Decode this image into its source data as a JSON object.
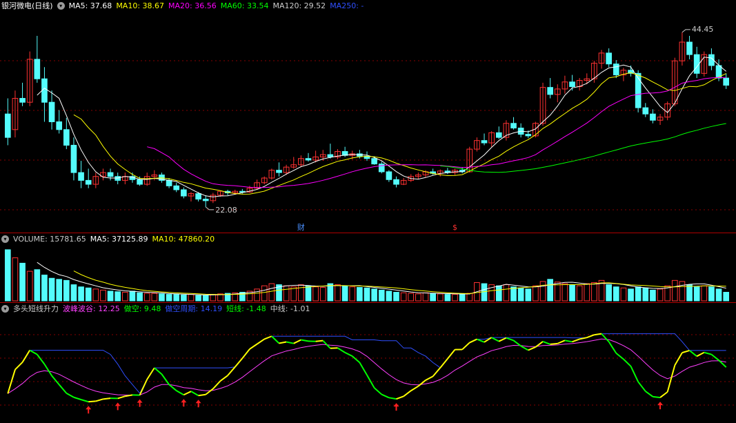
{
  "price_panel": {
    "title": "银河微电(日线)",
    "ma_items": [
      {
        "label": "MA5: 37.68",
        "color": "#ffffff"
      },
      {
        "label": "MA10: 38.67",
        "color": "#ffff00"
      },
      {
        "label": "MA20: 36.56",
        "color": "#ff00ff"
      },
      {
        "label": "MA60: 33.54",
        "color": "#00ff00"
      },
      {
        "label": "MA120: 29.52",
        "color": "#cccccc"
      },
      {
        "label": "MA250: -",
        "color": "#2f4fff"
      }
    ],
    "high_label": "44.45",
    "low_label": "22.08",
    "marker_cai": "财",
    "marker_dollar": "$"
  },
  "volume_panel": {
    "items": [
      {
        "label": "VOLUME: 15781.65",
        "color": "#cccccc"
      },
      {
        "label": "MA5: 37125.89",
        "color": "#ffffff"
      },
      {
        "label": "MA10: 47860.20",
        "color": "#ffff00"
      }
    ]
  },
  "indicator_panel": {
    "items": [
      {
        "label": "多头短线升力",
        "color": "#cccccc"
      },
      {
        "label": "波峰波谷: 12.25",
        "color": "#ff40ff"
      },
      {
        "label": "做空: 9.48",
        "color": "#00ff00"
      },
      {
        "label": "做空周期: 14.19",
        "color": "#2f4fff"
      },
      {
        "label": "短线: -1.48",
        "color": "#00ff00"
      },
      {
        "label": "中线: -1.01",
        "color": "#cccccc"
      }
    ]
  },
  "colors": {
    "up": "#ff3232",
    "down": "#54fcfc",
    "grid": "#8a0000",
    "ma5": "#ffffff",
    "ma10": "#ffff00",
    "ma20": "#ff00ff",
    "ma60": "#00ff00",
    "ma120": "#cccccc",
    "arrow": "#ff2020"
  },
  "chart_data": {
    "type": "candlestick",
    "price_range": [
      20.5,
      47.0
    ],
    "candles": [
      [
        34,
        36,
        30,
        31
      ],
      [
        32,
        37,
        31,
        36
      ],
      [
        36,
        38,
        35,
        35.5
      ],
      [
        35.5,
        42,
        35,
        41
      ],
      [
        41,
        44,
        38,
        38.5
      ],
      [
        38.5,
        40,
        33,
        35.5
      ],
      [
        35.5,
        37,
        32,
        33
      ],
      [
        33,
        34.5,
        31.5,
        32
      ],
      [
        32,
        33.5,
        29.5,
        30
      ],
      [
        30,
        31,
        25.5,
        26.5
      ],
      [
        26.5,
        28,
        24.5,
        25.5
      ],
      [
        25.5,
        27,
        24.5,
        25
      ],
      [
        25,
        26.5,
        24.5,
        26
      ],
      [
        26,
        27,
        25.5,
        26.5
      ],
      [
        26.5,
        27,
        25.5,
        26
      ],
      [
        26,
        26.5,
        25,
        25.5
      ],
      [
        25.5,
        26.5,
        25,
        26
      ],
      [
        26,
        26.5,
        25.2,
        25.6
      ],
      [
        25.6,
        26,
        24.8,
        25
      ],
      [
        25,
        26.5,
        24.8,
        26
      ],
      [
        26,
        26.8,
        25.5,
        26.2
      ],
      [
        26.2,
        26.5,
        25.2,
        25.5
      ],
      [
        25.5,
        25.8,
        24.5,
        24.8
      ],
      [
        24.8,
        25.2,
        24,
        24.3
      ],
      [
        24.3,
        24.6,
        23.2,
        23.5
      ],
      [
        23.5,
        24,
        22.8,
        23.8
      ],
      [
        23.8,
        24,
        22.8,
        23.1
      ],
      [
        23.1,
        23.6,
        22.1,
        22.9
      ],
      [
        22.9,
        23.9,
        22.6,
        23.6
      ],
      [
        23.6,
        24.2,
        23.4,
        24.1
      ],
      [
        24.1,
        24.3,
        23.6,
        23.9
      ],
      [
        23.9,
        24.3,
        23.7,
        24.1
      ],
      [
        24.1,
        24.4,
        23.8,
        24.0
      ],
      [
        24.0,
        24.8,
        23.9,
        24.5
      ],
      [
        24.5,
        25.6,
        24.4,
        25.2
      ],
      [
        25.2,
        26.0,
        25.0,
        25.8
      ],
      [
        25.8,
        27.0,
        25.6,
        26.8
      ],
      [
        26.8,
        27.8,
        26.0,
        26.5
      ],
      [
        26.5,
        27.5,
        26.2,
        27.2
      ],
      [
        27.2,
        28.5,
        27.0,
        27.5
      ],
      [
        27.5,
        28.7,
        27.2,
        28.3
      ],
      [
        28.3,
        29.0,
        27.9,
        28.1
      ],
      [
        28.1,
        29.3,
        27.8,
        28.5
      ],
      [
        28.5,
        29.4,
        28.0,
        28.8
      ],
      [
        28.8,
        30.2,
        28.3,
        28.5
      ],
      [
        28.5,
        29.5,
        28.2,
        29.2
      ],
      [
        29.2,
        29.8,
        28.5,
        28.7
      ],
      [
        28.7,
        29.3,
        28.2,
        28.9
      ],
      [
        28.9,
        29.4,
        28.3,
        28.6
      ],
      [
        28.6,
        29.2,
        28.0,
        28.3
      ],
      [
        28.3,
        28.6,
        27.5,
        27.6
      ],
      [
        27.6,
        27.9,
        26.4,
        26.6
      ],
      [
        26.6,
        26.8,
        25.3,
        25.6
      ],
      [
        25.6,
        26.0,
        24.6,
        25.0
      ],
      [
        25.0,
        25.8,
        24.9,
        25.5
      ],
      [
        25.5,
        26.3,
        25.3,
        26.0
      ],
      [
        26.0,
        26.5,
        25.7,
        26.2
      ],
      [
        26.2,
        26.8,
        25.9,
        26.6
      ],
      [
        26.6,
        27.0,
        26.2,
        26.4
      ],
      [
        26.4,
        26.9,
        26.0,
        26.7
      ],
      [
        26.7,
        27.1,
        26.3,
        26.5
      ],
      [
        26.5,
        27.0,
        26.2,
        26.8
      ],
      [
        26.8,
        27.2,
        26.4,
        26.6
      ],
      [
        26.6,
        29.8,
        26.5,
        29.5
      ],
      [
        29.5,
        31.0,
        29.2,
        30.6
      ],
      [
        30.6,
        31.5,
        30.0,
        30.3
      ],
      [
        30.3,
        31.8,
        29.8,
        31.6
      ],
      [
        31.6,
        32.4,
        30.8,
        31.0
      ],
      [
        31.0,
        33.2,
        30.6,
        32.8
      ],
      [
        32.8,
        33.6,
        32.0,
        32.2
      ],
      [
        32.2,
        32.8,
        31.0,
        31.4
      ],
      [
        31.4,
        31.9,
        30.9,
        31.2
      ],
      [
        31.2,
        33.0,
        31.0,
        32.8
      ],
      [
        32.8,
        38.0,
        32.5,
        37.4
      ],
      [
        37.4,
        38.6,
        36.0,
        36.5
      ],
      [
        36.5,
        37.8,
        35.5,
        37.2
      ],
      [
        37.2,
        38.9,
        36.6,
        38.1
      ],
      [
        38.1,
        39.0,
        37.0,
        37.5
      ],
      [
        37.5,
        38.6,
        37.0,
        38.3
      ],
      [
        38.3,
        39.2,
        37.8,
        38.5
      ],
      [
        38.5,
        40.8,
        38.0,
        40.5
      ],
      [
        40.5,
        42.2,
        39.8,
        41.8
      ],
      [
        41.8,
        42.4,
        40.0,
        40.4
      ],
      [
        40.4,
        40.9,
        38.6,
        39.0
      ],
      [
        39.0,
        39.9,
        38.2,
        39.6
      ],
      [
        39.6,
        40.2,
        38.8,
        39.2
      ],
      [
        39.2,
        39.6,
        34.2,
        34.8
      ],
      [
        34.8,
        35.4,
        33.6,
        34.0
      ],
      [
        34.0,
        34.6,
        32.8,
        33.2
      ],
      [
        33.2,
        34.0,
        32.6,
        33.6
      ],
      [
        33.6,
        35.6,
        33.2,
        35.3
      ],
      [
        35.3,
        41.2,
        35.0,
        40.8
      ],
      [
        40.8,
        44.45,
        40.2,
        43.2
      ],
      [
        43.2,
        44.0,
        41.0,
        41.6
      ],
      [
        41.6,
        42.6,
        38.6,
        39.2
      ],
      [
        39.2,
        42.0,
        38.8,
        41.6
      ],
      [
        41.6,
        42.4,
        39.6,
        40.2
      ],
      [
        40.2,
        41.0,
        38.2,
        38.6
      ],
      [
        38.6,
        39.2,
        37.2,
        37.68
      ]
    ],
    "volume_range": [
      0,
      100
    ],
    "volumes": [
      95,
      80,
      70,
      55,
      58,
      48,
      42,
      40,
      38,
      30,
      26,
      24,
      22,
      20,
      18,
      17,
      16,
      18,
      15,
      14,
      14,
      13,
      12,
      12,
      11,
      12,
      10,
      10,
      12,
      13,
      14,
      15,
      16,
      18,
      22,
      28,
      32,
      30,
      28,
      26,
      30,
      28,
      26,
      25,
      32,
      30,
      28,
      26,
      25,
      24,
      22,
      20,
      18,
      16,
      15,
      14,
      13,
      15,
      14,
      13,
      12,
      12,
      13,
      14,
      34,
      32,
      30,
      28,
      30,
      26,
      24,
      22,
      28,
      36,
      40,
      35,
      32,
      30,
      28,
      32,
      34,
      38,
      30,
      26,
      24,
      22,
      26,
      24,
      20,
      22,
      28,
      38,
      36,
      30,
      26,
      28,
      26,
      22,
      16
    ]
  }
}
